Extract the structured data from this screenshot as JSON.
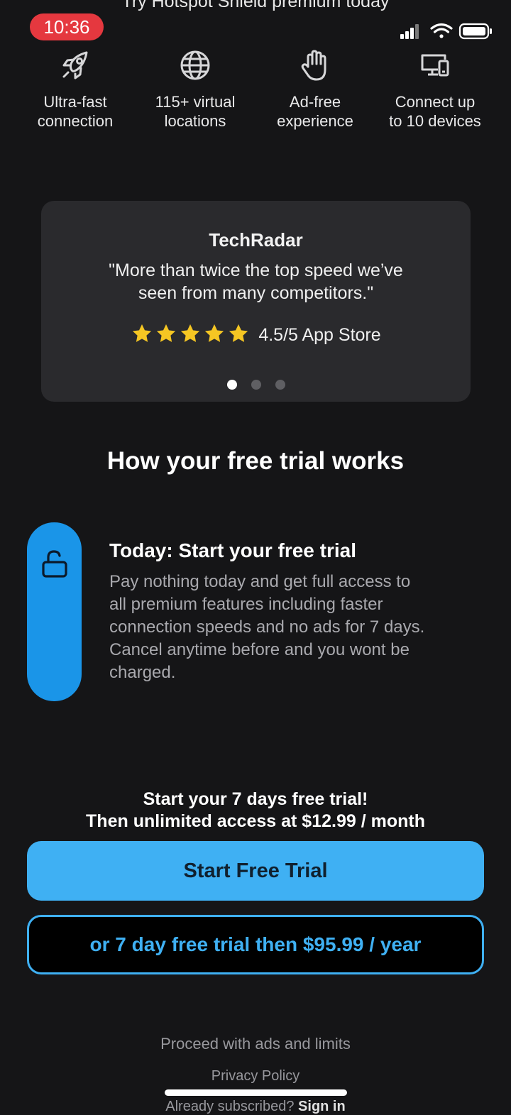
{
  "status_bar": {
    "time": "10:36",
    "time_pill_color": "#e5383f",
    "icons": [
      "signal-icon",
      "wifi-icon",
      "battery-icon"
    ]
  },
  "header": {
    "title_partial": "Try Hotspot Shield premium today"
  },
  "features": [
    {
      "icon": "rocket-icon",
      "label_line1": "Ultra-fast",
      "label_line2": "connection"
    },
    {
      "icon": "globe-icon",
      "label_line1": "115+ virtual",
      "label_line2": "locations"
    },
    {
      "icon": "hand-stop-icon",
      "label_line1": "Ad-free",
      "label_line2": "experience"
    },
    {
      "icon": "devices-icon",
      "label_line1": "Connect up",
      "label_line2": "to 10 devices"
    }
  ],
  "review": {
    "source": "TechRadar",
    "quote_line1": "\"More than twice the top speed we’ve",
    "quote_line2": "seen from many competitors.\"",
    "stars_count": 5,
    "star_color": "#f5c623",
    "rating_text": "4.5/5 App Store",
    "carousel_total": 3,
    "carousel_active_index": 0
  },
  "how_it_works": {
    "title": "How your free trial works",
    "steps": [
      {
        "icon": "unlock-icon",
        "title": "Today: Start your free trial",
        "desc_line1": "Pay nothing today and get full access to",
        "desc_line2": "all premium features including faster",
        "desc_line3": "connection speeds and no ads for 7 days.",
        "desc_line4": "Cancel anytime before and you wont be",
        "desc_line5": "charged."
      }
    ]
  },
  "offer": {
    "line1": "Start your 7 days free trial!",
    "line2": "Then unlimited access at $12.99 / month",
    "primary_button": "Start Free Trial",
    "secondary_button": "or 7 day free trial then $95.99 / year",
    "accent_color": "#3fb0f3"
  },
  "footer": {
    "proceed_link": "Proceed with ads and limits",
    "privacy_link": "Privacy Policy",
    "signin_prefix": "Already subscribed? ",
    "signin_link": "Sign in"
  }
}
